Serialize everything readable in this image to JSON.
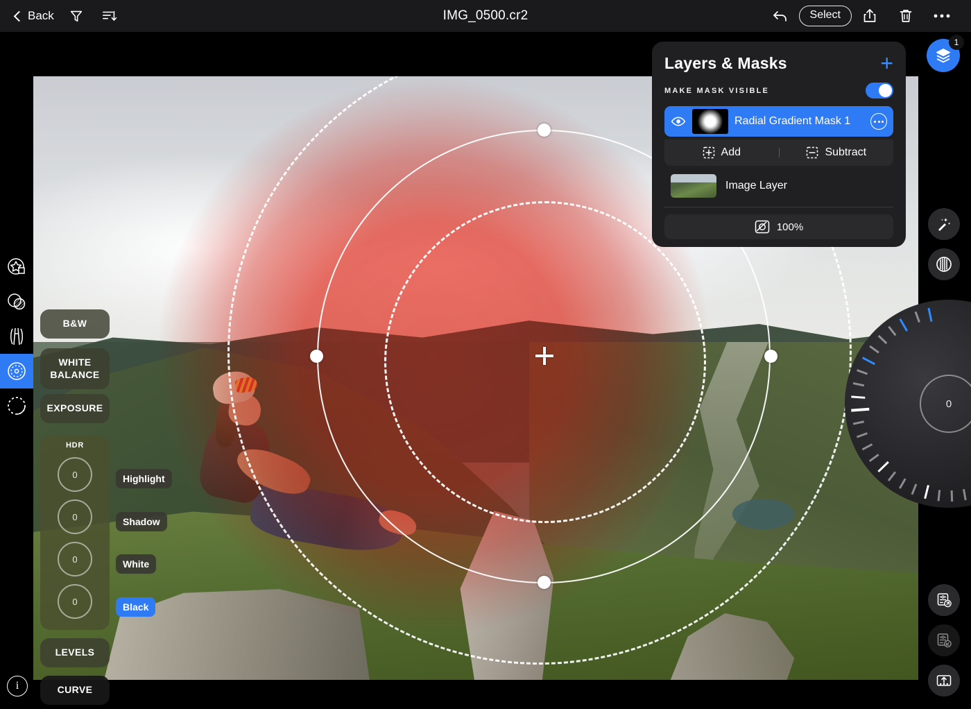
{
  "topbar": {
    "back_label": "Back",
    "filter_icon": "filter-funnel-icon",
    "sort_icon": "sort-descending-icon",
    "title": "IMG_0500.cr2",
    "undo_icon": "undo-arrow-icon",
    "select_label": "Select",
    "share_icon": "share-upload-icon",
    "delete_icon": "trash-icon",
    "more_icon": "more-ellipsis-icon"
  },
  "left_rail": {
    "items": [
      {
        "name": "magic-star-tool",
        "icon": "star-shape-icon",
        "active": false
      },
      {
        "name": "blend-tool",
        "icon": "overlapping-circles-icon",
        "active": false
      },
      {
        "name": "linear-gradient-tool",
        "icon": "linear-gradient-icon",
        "active": false
      },
      {
        "name": "radial-gradient-tool",
        "icon": "radial-gradient-icon",
        "active": true
      },
      {
        "name": "brush-mask-tool",
        "icon": "dotted-circle-icon",
        "active": false
      }
    ]
  },
  "adjustments": {
    "bw_label": "B&W",
    "white_balance_label": "WHITE BALANCE",
    "exposure_label": "EXPOSURE",
    "levels_label": "LEVELS",
    "curve_label": "CURVE",
    "hdr": {
      "group_label": "HDR",
      "dials": [
        {
          "label": "Highlight",
          "value": "0",
          "selected": false
        },
        {
          "label": "Shadow",
          "value": "0",
          "selected": false
        },
        {
          "label": "White",
          "value": "0",
          "selected": false
        },
        {
          "label": "Black",
          "value": "0",
          "selected": true
        }
      ]
    }
  },
  "layers_panel": {
    "title": "Layers & Masks",
    "add_icon": "plus-icon",
    "make_mask_visible_label": "MAKE MASK VISIBLE",
    "make_mask_visible_on": true,
    "mask_layer": {
      "name": "Radial Gradient Mask 1",
      "visibility_icon": "eye-icon",
      "options_icon": "more-ellipsis-circle-icon",
      "selected": true
    },
    "add_label": "Add",
    "subtract_label": "Subtract",
    "image_layer_label": "Image Layer",
    "opacity_value": "100%",
    "opacity_icon": "opacity-icon"
  },
  "right_rail": {
    "layers_fab_icon": "layers-stack-icon",
    "layers_badge": "1",
    "magic_wand_icon": "magic-wand-icon",
    "contrast_icon": "half-striped-circle-icon",
    "save_preset_icon": "preset-save-icon",
    "load_preset_icon": "preset-load-icon",
    "export_preset_icon": "preset-export-icon",
    "wheel_value": "0"
  },
  "canvas": {
    "info_icon": "info-icon",
    "center_marker": "radial-gradient-center-crosshair",
    "handles": [
      "handle-left",
      "handle-top",
      "handle-right",
      "handle-bottom"
    ]
  },
  "colors": {
    "accent": "#2f7bf6",
    "panel_bg": "#202022",
    "topbar_bg": "#1a1a1c",
    "mask_tint": "#d82018"
  }
}
